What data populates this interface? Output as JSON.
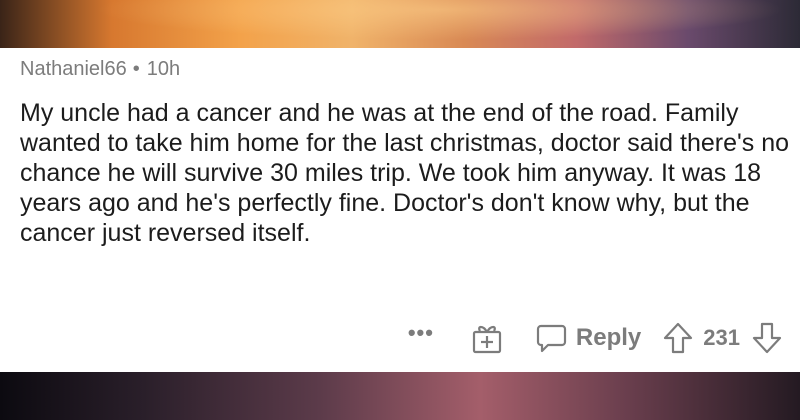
{
  "comment": {
    "author": "Nathaniel66",
    "separator": "•",
    "age": "10h",
    "body": "My uncle had a cancer and he was at the end of the road. Family wanted to take him home for the last christmas, doctor said there's no chance he will survive 30 miles trip. We took him anyway. It was 18 years ago and he's perfectly fine. Doctor's don't know why, but the cancer just reversed itself."
  },
  "actions": {
    "more_label": "•••",
    "reply_label": "Reply",
    "score": "231"
  },
  "icons": {
    "more": "more-options-icon",
    "gift": "gift-award-icon",
    "reply": "speech-bubble-icon",
    "upvote": "arrow-up-icon",
    "downvote": "arrow-down-icon"
  },
  "colors": {
    "meta_text": "#7c7c7c",
    "body_text": "#1c1c1c",
    "card_bg": "#ffffff"
  }
}
